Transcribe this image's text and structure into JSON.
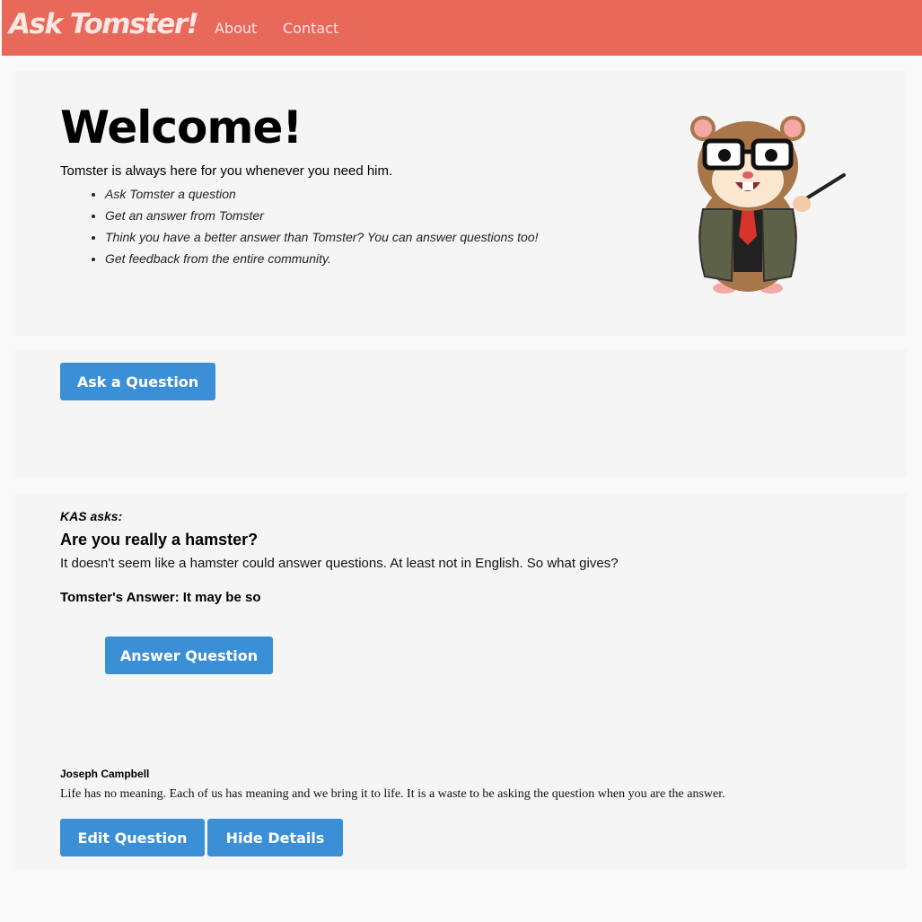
{
  "navbar": {
    "brand": "Ask Tomster!",
    "links": [
      "About",
      "Contact"
    ],
    "background": "#e8685a"
  },
  "welcome": {
    "title": "Welcome!",
    "lead": "Tomster is always here for you whenever you need him.",
    "features": [
      "Ask Tomster a question",
      "Get an answer from Tomster",
      "Think you have a better answer than Tomster? You can answer questions too!",
      "Get feedback from the entire community."
    ],
    "mascot_icon": "tomster-hamster-with-glasses-and-pointer"
  },
  "ask": {
    "button_label": "Ask a Question"
  },
  "question": {
    "asker": "KAS asks:",
    "title": "Are you really a hamster?",
    "body": "It doesn't seem like a hamster could answer questions. At least not in English. So what gives?",
    "answer_prefix": "Tomster's Answer:",
    "answer_text": "It may be so",
    "answer_button": "Answer Question",
    "quote_author": "Joseph Campbell",
    "quote_text": "Life has no meaning. Each of us has meaning and we bring it to life. It is a waste to be asking the question when you are the answer.",
    "edit_button": "Edit Question",
    "hide_button": "Hide Details"
  },
  "colors": {
    "accent": "#3b8fd6",
    "panel": "#f5f5f5"
  }
}
